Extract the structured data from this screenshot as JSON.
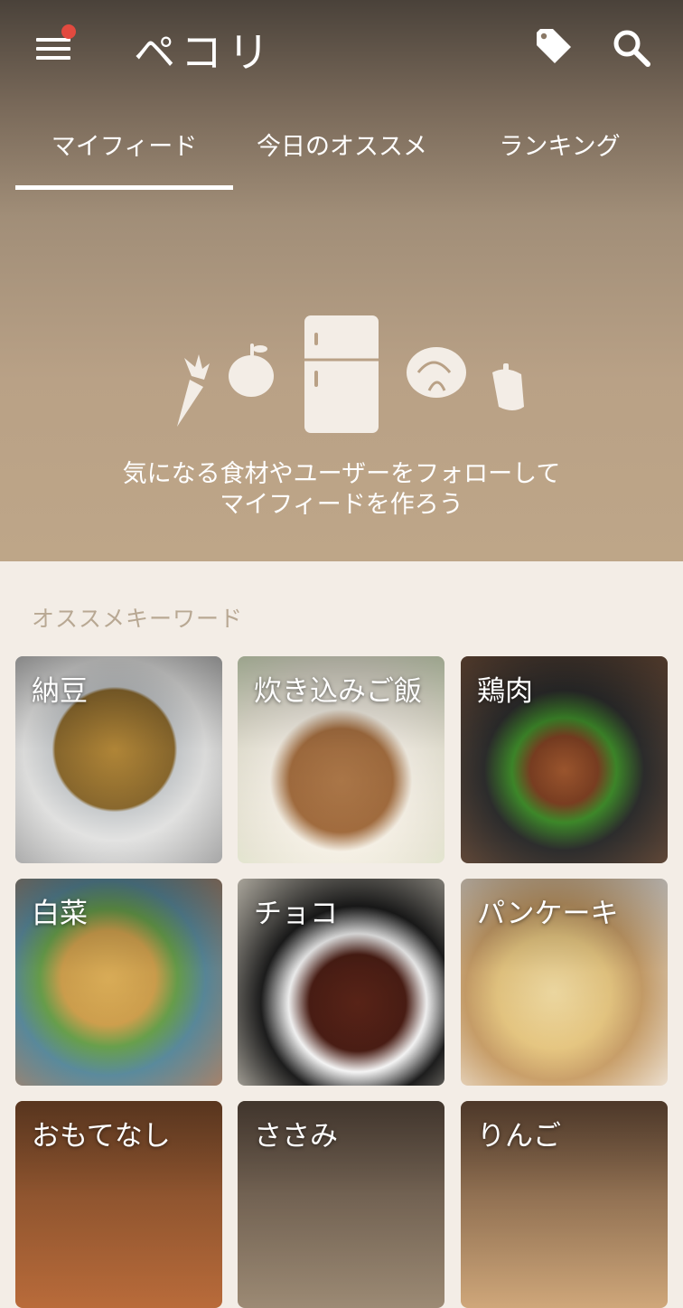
{
  "header": {
    "app_title": "ペコリ",
    "menu_icon": "hamburger-menu-icon",
    "notification_color": "#e24a3f",
    "tag_icon": "tag-icon",
    "search_icon": "search-icon"
  },
  "tabs": [
    {
      "label": "マイフィード",
      "active": true
    },
    {
      "label": "今日のオススメ",
      "active": false
    },
    {
      "label": "ランキング",
      "active": false
    }
  ],
  "empty_state": {
    "icons": [
      "carrot-icon",
      "apple-icon",
      "refrigerator-icon",
      "cabbage-icon",
      "pepper-icon"
    ],
    "line1": "気になる食材やユーザーをフォローして",
    "line2": "マイフィードを作ろう"
  },
  "keywords": {
    "title": "オススメキーワード",
    "items": [
      {
        "label": "納豆"
      },
      {
        "label": "炊き込みご飯"
      },
      {
        "label": "鶏肉"
      },
      {
        "label": "白菜"
      },
      {
        "label": "チョコ"
      },
      {
        "label": "パンケーキ"
      },
      {
        "label": "おもてなし"
      },
      {
        "label": "ささみ"
      },
      {
        "label": "りんご"
      }
    ]
  }
}
